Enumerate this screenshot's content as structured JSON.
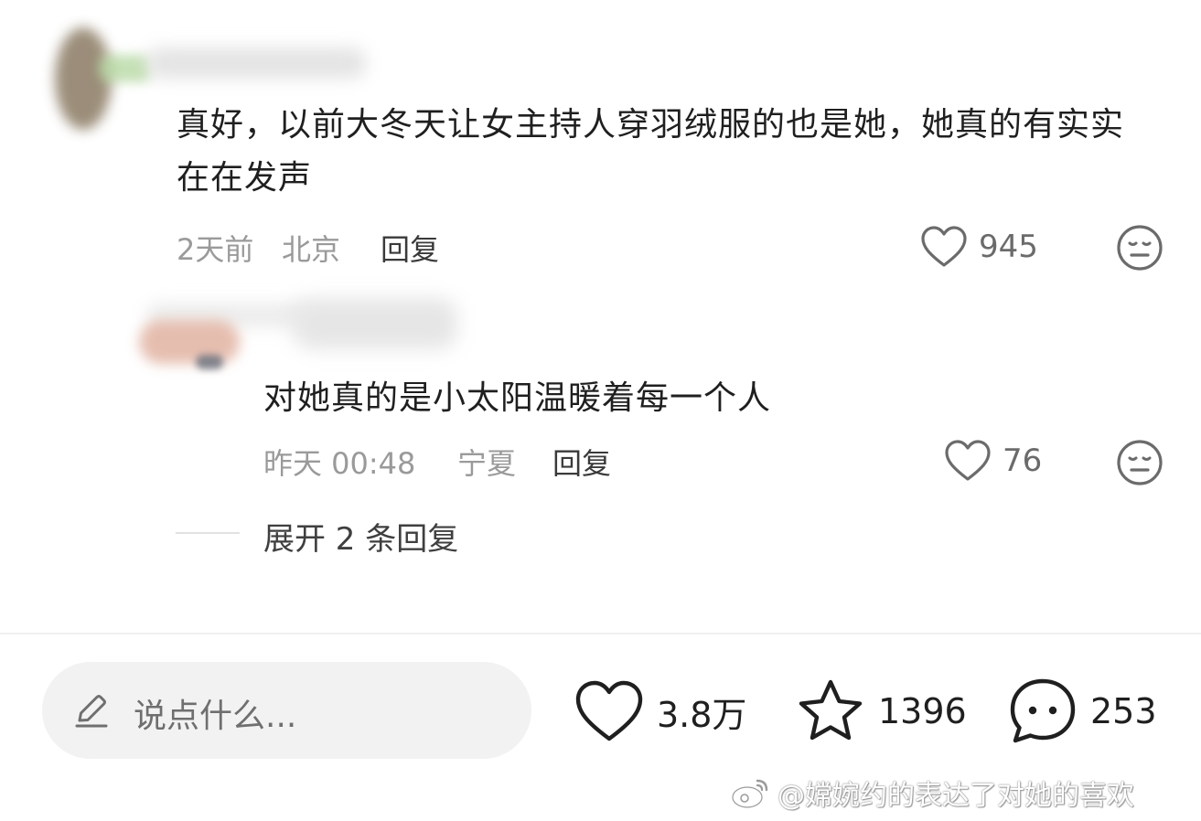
{
  "comment": {
    "text": "真好，以前大冬天让女主持人穿羽绒服的也是她，她真的有实实在在发声",
    "time": "2天前",
    "location": "北京",
    "reply_label": "回复",
    "likes": "945"
  },
  "reply": {
    "text": "对她真的是小太阳温暖着每一个人",
    "time": "昨天 00:48",
    "location": "宁夏",
    "reply_label": "回复",
    "likes": "76"
  },
  "expand_replies": "展开 2 条回复",
  "bottom_bar": {
    "input_placeholder": "说点什么...",
    "likes": "3.8万",
    "favorites": "1396",
    "comments": "253"
  },
  "watermark": "@嫦婉约的表达了对她的喜欢",
  "icons": {
    "like": "heart-icon",
    "dislike": "meh-face-icon",
    "favorite": "star-icon",
    "comment": "speech-bubble-icon",
    "edit": "pencil-icon",
    "weibo": "weibo-logo-icon"
  }
}
